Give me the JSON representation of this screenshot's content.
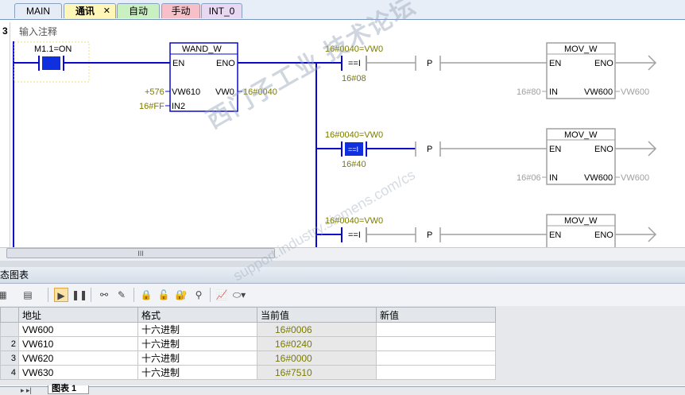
{
  "tabs": [
    {
      "label": "MAIN"
    },
    {
      "label": "通讯",
      "close": "✕"
    },
    {
      "label": "自动"
    },
    {
      "label": "手动"
    },
    {
      "label": "INT_0"
    }
  ],
  "network": {
    "number": "3",
    "comment": "输入注释",
    "contact": {
      "label": "M1.1=ON"
    },
    "wand": {
      "title": "WAND_W",
      "en": "EN",
      "eno": "ENO",
      "in1_value": "+576",
      "in1_pin": "VW610",
      "in2_value": "16#FF",
      "in2_pin": "IN2",
      "out_pin": "VW0",
      "out_value": "16#0040"
    },
    "rungs": [
      {
        "compare_top": "16#0040=VW0",
        "op": "==I",
        "compare_bottom": "16#08",
        "p": "P",
        "mov": {
          "title": "MOV_W",
          "en": "EN",
          "eno": "ENO",
          "in_value": "16#80",
          "in_pin": "IN",
          "out_pin": "VW600",
          "out_value": "VW600"
        }
      },
      {
        "compare_top": "16#0040=VW0",
        "op": "==I",
        "compare_bottom": "16#40",
        "p": "P",
        "mov": {
          "title": "MOV_W",
          "en": "EN",
          "eno": "ENO",
          "in_value": "16#06",
          "in_pin": "IN",
          "out_pin": "VW600",
          "out_value": "VW600"
        }
      },
      {
        "compare_top": "16#0040=VW0",
        "op": "==I",
        "compare_bottom": "",
        "p": "P",
        "mov": {
          "title": "MOV_W",
          "en": "EN",
          "eno": "ENO"
        }
      }
    ]
  },
  "scrollbar": {
    "thumb_grip": "III"
  },
  "status_chart": {
    "title": "态图表",
    "columns": [
      "地址",
      "格式",
      "当前值",
      "新值"
    ],
    "rows": [
      {
        "num": "",
        "address": "VW600",
        "format": "十六进制",
        "current": "16#0006",
        "new": ""
      },
      {
        "num": "2",
        "address": "VW610",
        "format": "十六进制",
        "current": "16#0240",
        "new": ""
      },
      {
        "num": "3",
        "address": "VW620",
        "format": "十六进制",
        "current": "16#0000",
        "new": ""
      },
      {
        "num": "4",
        "address": "VW630",
        "format": "十六进制",
        "current": "16#7510",
        "new": ""
      }
    ],
    "sheet_tab": "图表 1",
    "tab_nav": "▸ ▸|"
  },
  "watermark": {
    "line1": "西门子工业 技术论坛",
    "line2": "support.industry.siemens.com/cs"
  },
  "colors": {
    "rung": "#0a0ac8",
    "inactive": "#a0a0a0",
    "value_text": "#7a7a00",
    "highlight_block": "#1030e0"
  }
}
